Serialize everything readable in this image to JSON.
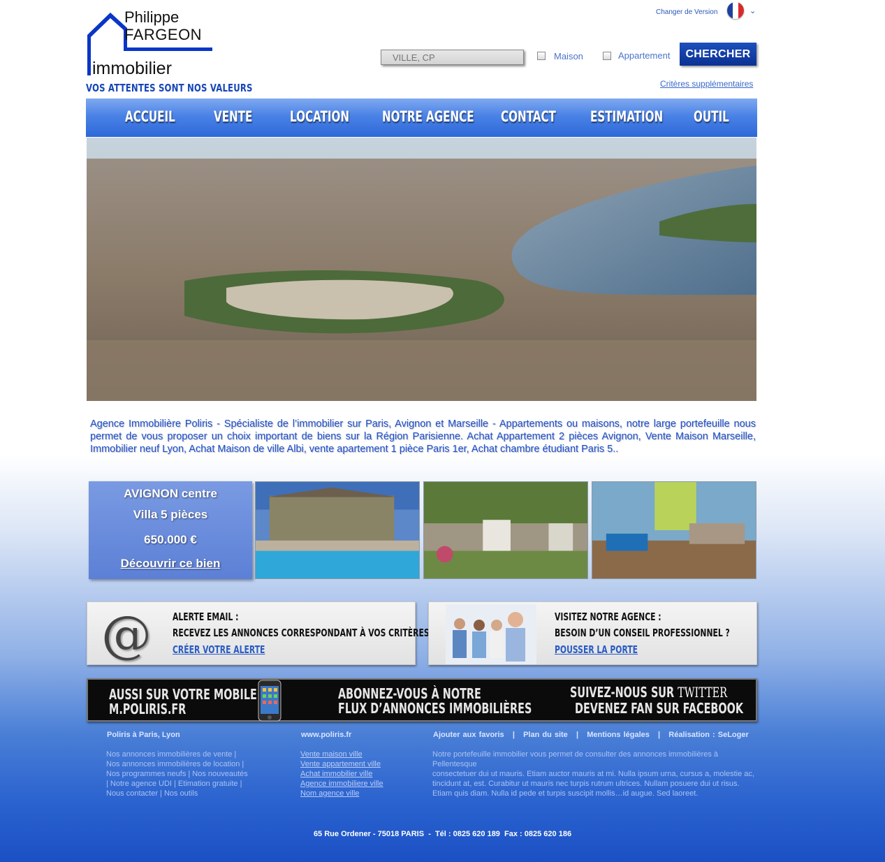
{
  "logo": {
    "name_line1": "Philippe",
    "name_line2": "FARGEON",
    "name_line3": "immobilier",
    "tagline": "VOS ATTENTES SONT NOS VALEURS",
    "color": "#0a35c8"
  },
  "version": {
    "label": "Changer de Version",
    "flag_icon": "french-flag-icon"
  },
  "search": {
    "placeholder": "VILLE, CP",
    "type_house": "Maison",
    "type_apartment": "Appartement",
    "button": "CHERCHER",
    "more_criteria": "Critères supplémentaires"
  },
  "nav": {
    "items": [
      "ACCUEIL",
      "VENTE",
      "LOCATION",
      "NOTRE AGENCE",
      "CONTACT",
      "ESTIMATION",
      "OUTIL"
    ]
  },
  "intro": "Agence Immobilière Poliris - Spécialiste de l’immobilier sur Paris, Avignon et Marseille - Appartements ou maisons, notre large portefeuille nous permet de vous proposer un choix important de biens sur la Région Parisienne. Achat Appartement 2 pièces Avignon, Vente Maison Marseille, Immobilier neuf Lyon, Achat Maison de ville Albi, vente apartement 1 pièce Paris 1er, Achat chambre étudiant Paris 5..",
  "featured": {
    "location": "AVIGNON centre",
    "type": "Villa 5 pièces",
    "price": "650.000 €",
    "cta": "Découvrir ce bien"
  },
  "promos": {
    "alert": {
      "title": "ALERTE EMAIL :",
      "text": "RECEVEZ LES ANNONCES CORRESPONDANT À VOS CRITÈRES",
      "link": "CRÉER VOTRE ALERTE"
    },
    "agency": {
      "title": "VISITEZ NOTRE AGENCE :",
      "text": "BESOIN D’UN CONSEIL PROFESSIONNEL ?",
      "link": "POUSSER LA PORTE"
    }
  },
  "banner": {
    "mobile_line1": "AUSSI SUR VOTRE  MOBILE",
    "mobile_line2": "M.POLIRIS.FR",
    "rss_line1": "ABONNEZ-VOUS À NOTRE",
    "rss_line2": "FLUX D’ANNONCES IMMOBILIÈRES",
    "social_line1": "SUIVEZ-NOUS SUR",
    "social_twitter": "TWITTER",
    "social_line2": "DEVENEZ FAN SUR FACEBOOK"
  },
  "footer": {
    "col1_title": "Poliris à Paris, Lyon",
    "col1_lines": [
      "Nos annonces immobilières de vente |",
      "Nos annonces immobilières de location |",
      "Nos programmes neufs | Nos nouveautés",
      "| Notre agence UDI | Etimation gratuite |",
      "Nous contacter | Nos outils"
    ],
    "col2_title": "www.poliris.fr",
    "col2_links": [
      "Vente maison ville",
      "Vente appartement ville",
      "Achat immobilier ville",
      "Agence immobiliere ville",
      "Nom agence ville"
    ],
    "links": [
      "Ajouter aux favoris",
      "Plan du site",
      "Mentions légales",
      "Réalisation : SeLoger"
    ],
    "sep": "|",
    "col3_lines": [
      "Notre portefeuille immobilier vous permet de consulter des annonces immobilières à Pellentesque",
      "consectetuer dui ut mauris. Etiam auctor mauris at mi. Nulla ipsum urna, cursus a, molestie ac,",
      "tincidunt at, est. Curabitur ut mauris nec turpis rutrum ultrices. Nullam posuere dui ut risus.",
      "Etiam quis diam. Nulla id pede et turpis suscipit mollis…id augue. Sed laoreet."
    ],
    "address": "65 Rue Ordener - 75018 PARIS  -  Tél : 0825 620 189  Fax : 0825 620 186"
  }
}
